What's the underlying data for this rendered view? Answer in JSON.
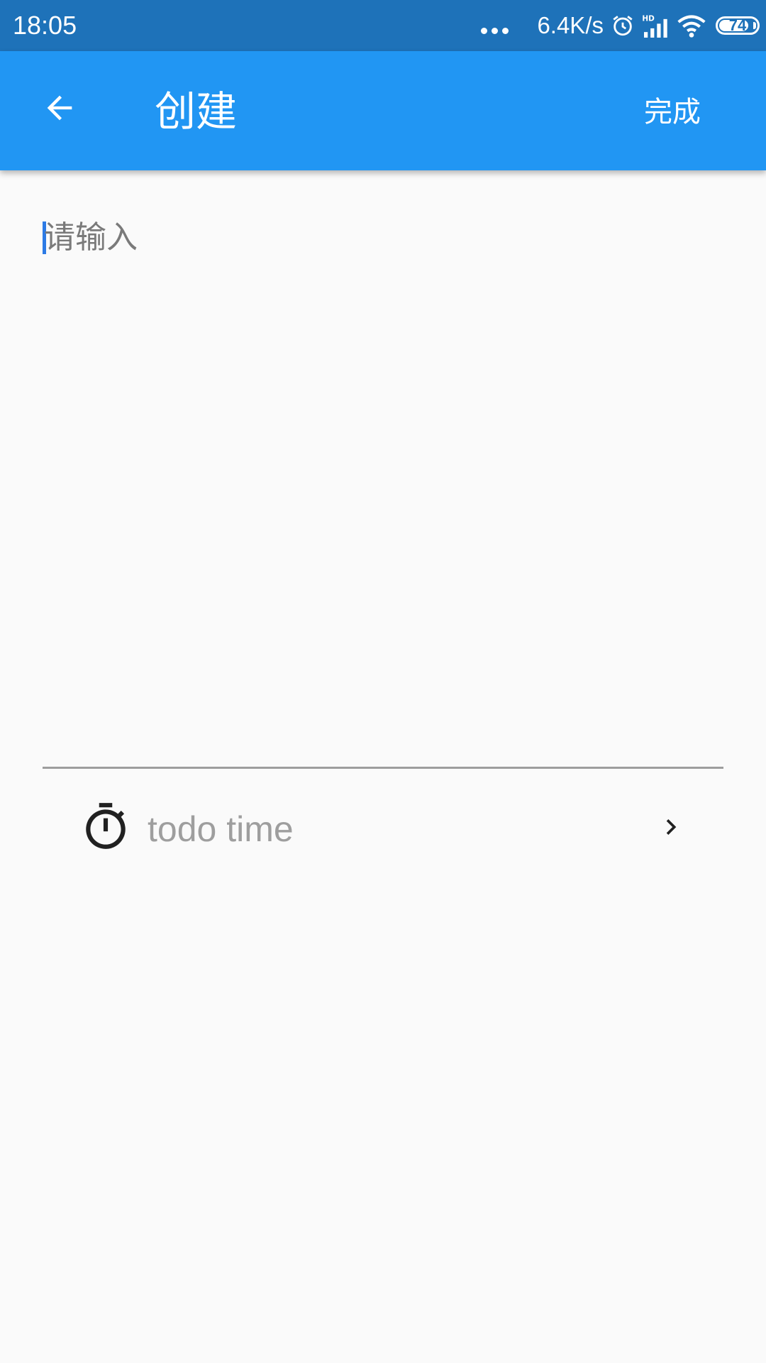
{
  "status_bar": {
    "time": "18:05",
    "network_speed": "6.4K/s",
    "battery_level": "74",
    "icons": [
      "more-dots-icon",
      "alarm-icon",
      "hd-signal-icon",
      "wifi-icon",
      "battery-icon"
    ]
  },
  "app_bar": {
    "back_icon": "arrow-back-icon",
    "title": "创建",
    "done_label": "完成"
  },
  "editor": {
    "placeholder": "请输入"
  },
  "todo_time": {
    "icon": "timer-icon",
    "label": "todo time",
    "trailing_icon": "chevron-right-icon"
  },
  "colors": {
    "status_bar": "#1E72B9",
    "app_bar": "#2196F3",
    "background": "#FAFAFA",
    "cursor": "#2D7BE5",
    "placeholder_text": "#7A7A7A",
    "secondary_text": "#9E9E9E"
  }
}
